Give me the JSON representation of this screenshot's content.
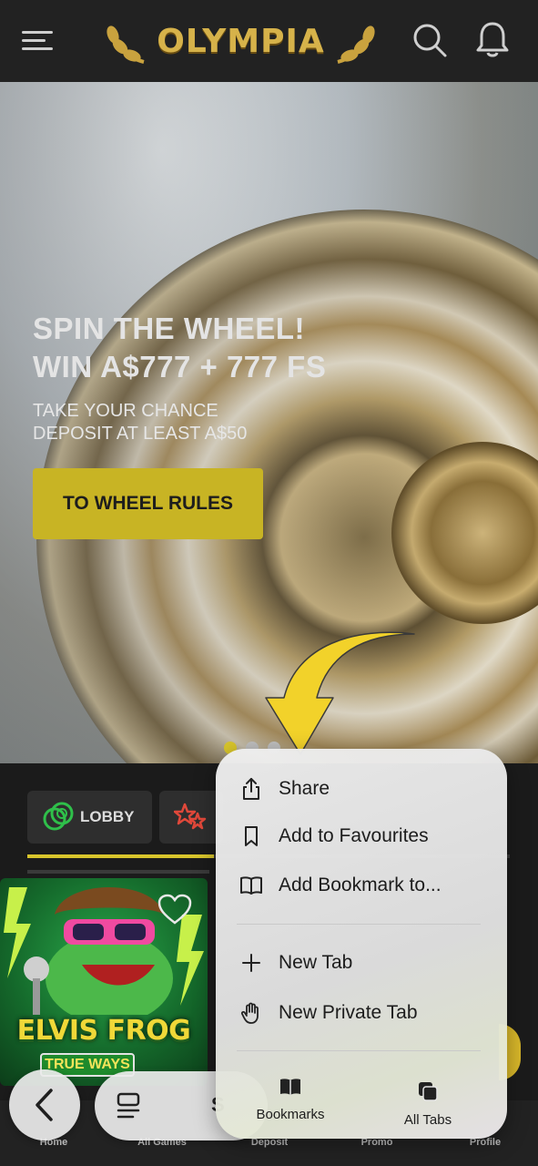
{
  "header": {
    "logo_text": "OLYMPIA"
  },
  "icons": {
    "menu": "hamburger-menu-icon",
    "search": "search-icon",
    "notifications": "bell-icon",
    "favorite": "heart-icon",
    "back": "chevron-left-icon"
  },
  "hero": {
    "title_line1": "SPIN THE WHEEL!",
    "title_line2": "WIN A$777 + 777 FS",
    "subtitle_line1": "TAKE YOUR CHANCE",
    "subtitle_line2": "DEPOSIT AT LEAST A$50",
    "cta_label": "TO WHEEL RULES",
    "carousel_slides": 3,
    "carousel_active": 1
  },
  "categories": {
    "lobby_label": "LOBBY"
  },
  "game": {
    "title": "ELVIS FROG",
    "subtitle": "TRUE WAYS"
  },
  "bottom_nav": {
    "items": [
      "Home",
      "All Games",
      "Deposit",
      "Promo",
      "Profile"
    ]
  },
  "browser": {
    "address_partial": "S"
  },
  "context_menu": {
    "items": [
      "Share",
      "Add to Favourites",
      "Add Bookmark to...",
      "New Tab",
      "New Private Tab"
    ],
    "bottom": [
      "Bookmarks",
      "All Tabs"
    ]
  },
  "colors": {
    "accent_yellow": "#C8B424",
    "header_bg": "#222222",
    "logo_gold": "#D6B24A",
    "arrow_yellow": "#F2D22A"
  }
}
